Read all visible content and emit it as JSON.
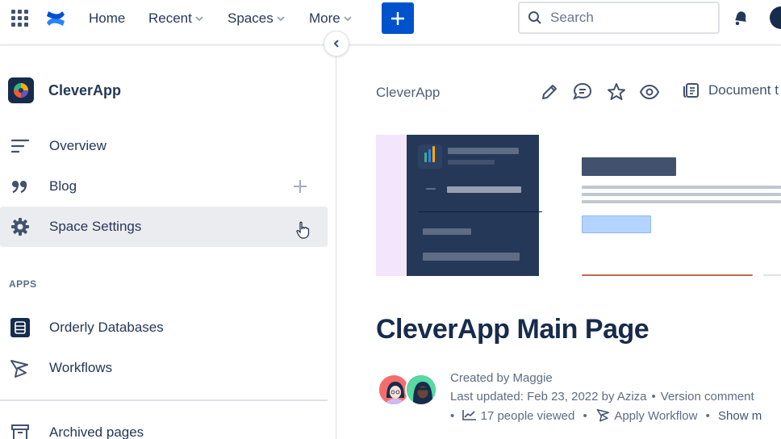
{
  "topnav": {
    "items": [
      {
        "label": "Home"
      },
      {
        "label": "Recent"
      },
      {
        "label": "Spaces"
      },
      {
        "label": "More"
      }
    ],
    "search_placeholder": "Search"
  },
  "sidebar": {
    "space_name": "CleverApp",
    "items": [
      {
        "label": "Overview",
        "icon": "overview-icon"
      },
      {
        "label": "Blog",
        "icon": "blog-quote-icon"
      },
      {
        "label": "Space Settings",
        "icon": "gear-icon"
      }
    ],
    "apps_label": "APPS",
    "apps": [
      {
        "label": "Orderly Databases",
        "icon": "database-icon"
      },
      {
        "label": "Workflows",
        "icon": "workflow-icon"
      }
    ],
    "archived_label": "Archived pages"
  },
  "main": {
    "breadcrumb": "CleverApp",
    "document_label": "Document t",
    "title": "CleverApp Main Page",
    "created_by": "Created by Maggie",
    "last_updated": "Last updated: Feb 23, 2022 by Aziza",
    "version_comment": "Version comment",
    "people_viewed": "17 people viewed",
    "apply_workflow": "Apply Workflow",
    "show_more": "Show m"
  },
  "colors": {
    "primary": "#0052cc",
    "text": "#172b4d",
    "subtle": "#5e6c84",
    "active_bg": "#ebecf0"
  }
}
